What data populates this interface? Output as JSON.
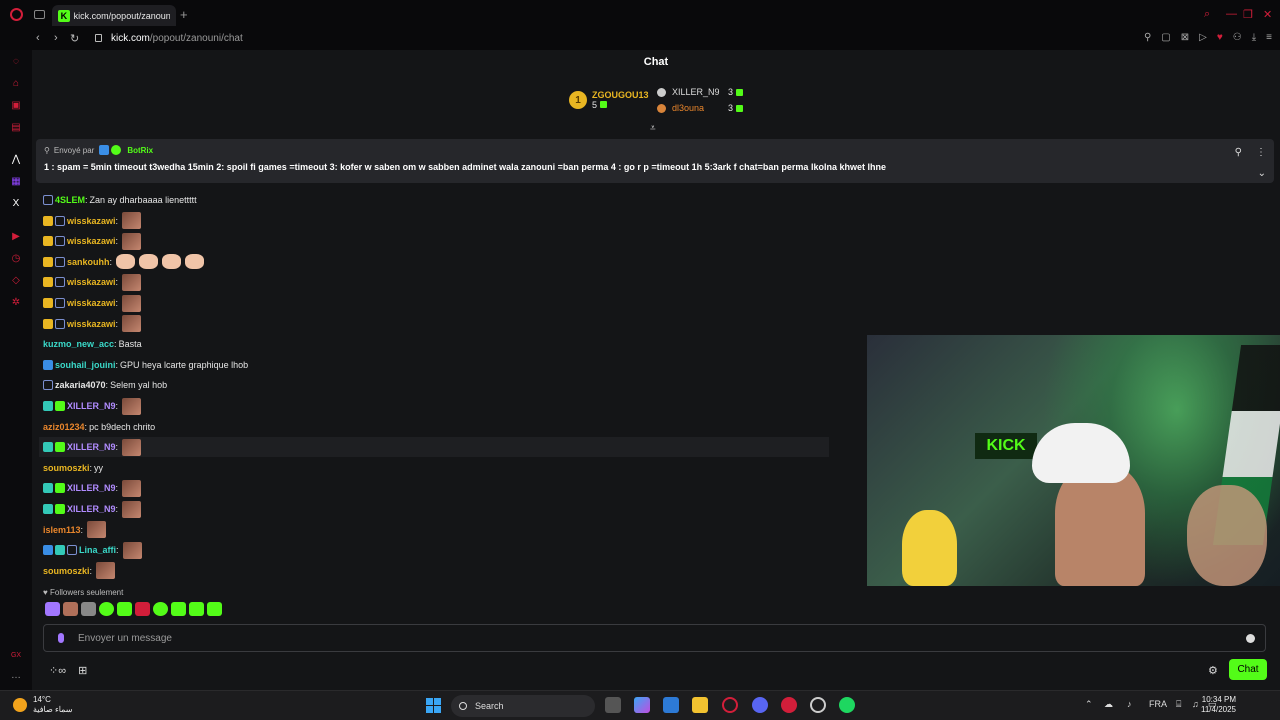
{
  "browser": {
    "tab_title": "kick.com/popout/zanouni",
    "url_host": "kick.com",
    "url_path": "/popout/zanouni/chat"
  },
  "chat": {
    "title": "Chat",
    "leaderboard": [
      {
        "rank": "1",
        "name": "ZGOUGOU13",
        "count": "5"
      },
      {
        "name": "XILLER_N9",
        "count": "3"
      },
      {
        "name": "dl3ouna",
        "count": "3"
      }
    ],
    "pinned": {
      "sent_by": "Envoyé par",
      "author": "BotRix",
      "message": "1 : spam = 5min timeout t3wedha 15min 2: spoil fi games =timeout 3: kofer w saben om w sabben adminet wala zanouni =ban perma 4 : go r p =timeout 1h 5:3ark f chat=ban perma lkolna khwet lhne"
    },
    "messages": [
      {
        "user": "4SLEM",
        "text": "Zan ay dharbaaaa lienettttt",
        "color": "#53fc18",
        "badges": [
          "hand"
        ],
        "emotes": 0
      },
      {
        "user": "wisskazawi",
        "text": "",
        "color": "#e9b622",
        "badges": [
          "crown",
          "hand"
        ],
        "emotes": 1
      },
      {
        "user": "wisskazawi",
        "text": "",
        "color": "#e9b622",
        "badges": [
          "crown",
          "hand"
        ],
        "emotes": 1
      },
      {
        "user": "sankouhh",
        "text": "",
        "color": "#e9b622",
        "badges": [
          "crown",
          "hand"
        ],
        "emotes": 4,
        "flex": true
      },
      {
        "user": "wisskazawi",
        "text": "",
        "color": "#e9b622",
        "badges": [
          "crown",
          "hand"
        ],
        "emotes": 1
      },
      {
        "user": "wisskazawi",
        "text": "",
        "color": "#e9b622",
        "badges": [
          "crown",
          "hand"
        ],
        "emotes": 1
      },
      {
        "user": "wisskazawi",
        "text": "",
        "color": "#e9b622",
        "badges": [
          "crown",
          "hand"
        ],
        "emotes": 1
      },
      {
        "user": "kuzmo_new_acc",
        "text": "Basta",
        "color": "#3ad9c9",
        "badges": [],
        "emotes": 0
      },
      {
        "user": "souhail_jouini",
        "text": "GPU heya lcarte graphique lhob",
        "color": "#3ad9c9",
        "badges": [
          "blue"
        ],
        "emotes": 0
      },
      {
        "user": "zakaria4070",
        "text": "Selem yal hob",
        "color": "#e6e6e6",
        "badges": [
          "hand"
        ],
        "emotes": 0
      },
      {
        "user": "XILLER_N9",
        "text": "",
        "color": "#b18cff",
        "badges": [
          "cyan",
          "green"
        ],
        "emotes": 1
      },
      {
        "user": "aziz01234",
        "text": "pc b9dech chrito",
        "color": "#e9862c",
        "badges": [],
        "emotes": 0
      },
      {
        "user": "XILLER_N9",
        "text": "",
        "color": "#b18cff",
        "badges": [
          "cyan",
          "green"
        ],
        "emotes": 1,
        "highlight": true
      },
      {
        "user": "soumoszki",
        "text": "yy",
        "color": "#e9b622",
        "badges": [],
        "emotes": 0
      },
      {
        "user": "XILLER_N9",
        "text": "",
        "color": "#b18cff",
        "badges": [
          "cyan",
          "green"
        ],
        "emotes": 1
      },
      {
        "user": "XILLER_N9",
        "text": "",
        "color": "#b18cff",
        "badges": [
          "cyan",
          "green"
        ],
        "emotes": 1
      },
      {
        "user": "islem113",
        "text": "",
        "color": "#e9862c",
        "badges": [],
        "emotes": 1
      },
      {
        "user": "Lina_affi",
        "text": "",
        "color": "#3ad9c9",
        "badges": [
          "blue",
          "cyan",
          "hand"
        ],
        "emotes": 1
      },
      {
        "user": "soumoszki",
        "text": "",
        "color": "#e9b622",
        "badges": [],
        "emotes": 1
      }
    ],
    "followers_only": "Followers seulement",
    "input_placeholder": "Envoyer un message",
    "chat_button": "Chat"
  },
  "taskbar": {
    "temp": "14°C",
    "weather_desc": "سماء صافية",
    "search_label": "Search",
    "lang": "FRA",
    "time": "10:34 PM",
    "date": "11/4/2025"
  },
  "colors": {
    "accent": "#53fc18",
    "brand_red": "#d21e3a"
  }
}
